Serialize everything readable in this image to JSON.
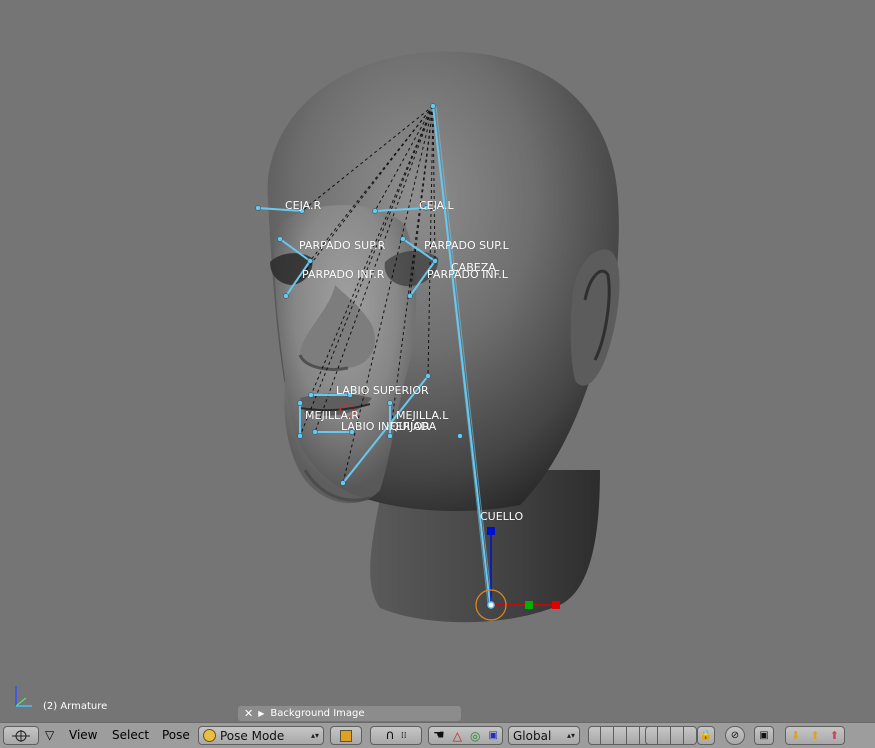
{
  "viewport": {
    "object_label": "(2) Armature",
    "bones": [
      {
        "name": "CEJA.R",
        "label": "CEJA.R"
      },
      {
        "name": "CEJA.L",
        "label": "CEJA.L"
      },
      {
        "name": "PARPADO SUP.R",
        "label": "PARPADO SUP.R"
      },
      {
        "name": "PARPADO SUP.L",
        "label": "PARPADO SUP.L"
      },
      {
        "name": "CABEZA",
        "label": "CABEZA"
      },
      {
        "name": "PARPADO INF.R",
        "label": "PARPADO INF.R"
      },
      {
        "name": "PARPADO INF.L",
        "label": "PARPADO INF.L"
      },
      {
        "name": "LABIO SUPERIOR",
        "label": "LABIO SUPERIOR"
      },
      {
        "name": "MEJILLA.R",
        "label": "MEJILLA.R"
      },
      {
        "name": "MEJILLA.L",
        "label": "MEJILLA.L"
      },
      {
        "name": "LABIO INFERIOR",
        "label": "LABIO INFERIOR"
      },
      {
        "name": "QUIJADA",
        "label": "QUIJADA"
      },
      {
        "name": "CUELLO",
        "label": "CUELLO"
      }
    ],
    "background_panel": {
      "label": "Background Image"
    }
  },
  "header": {
    "menus": {
      "view": "View",
      "select": "Select",
      "pose": "Pose"
    },
    "mode": "Pose Mode",
    "orientation": "Global"
  },
  "colors": {
    "background": "#757575",
    "bone": "#68c8ef",
    "header": "#9d9d9d",
    "manipulator_x": "#e00000",
    "manipulator_y": "#00b000",
    "manipulator_z": "#0010d0",
    "pivot": "#e08a20"
  }
}
